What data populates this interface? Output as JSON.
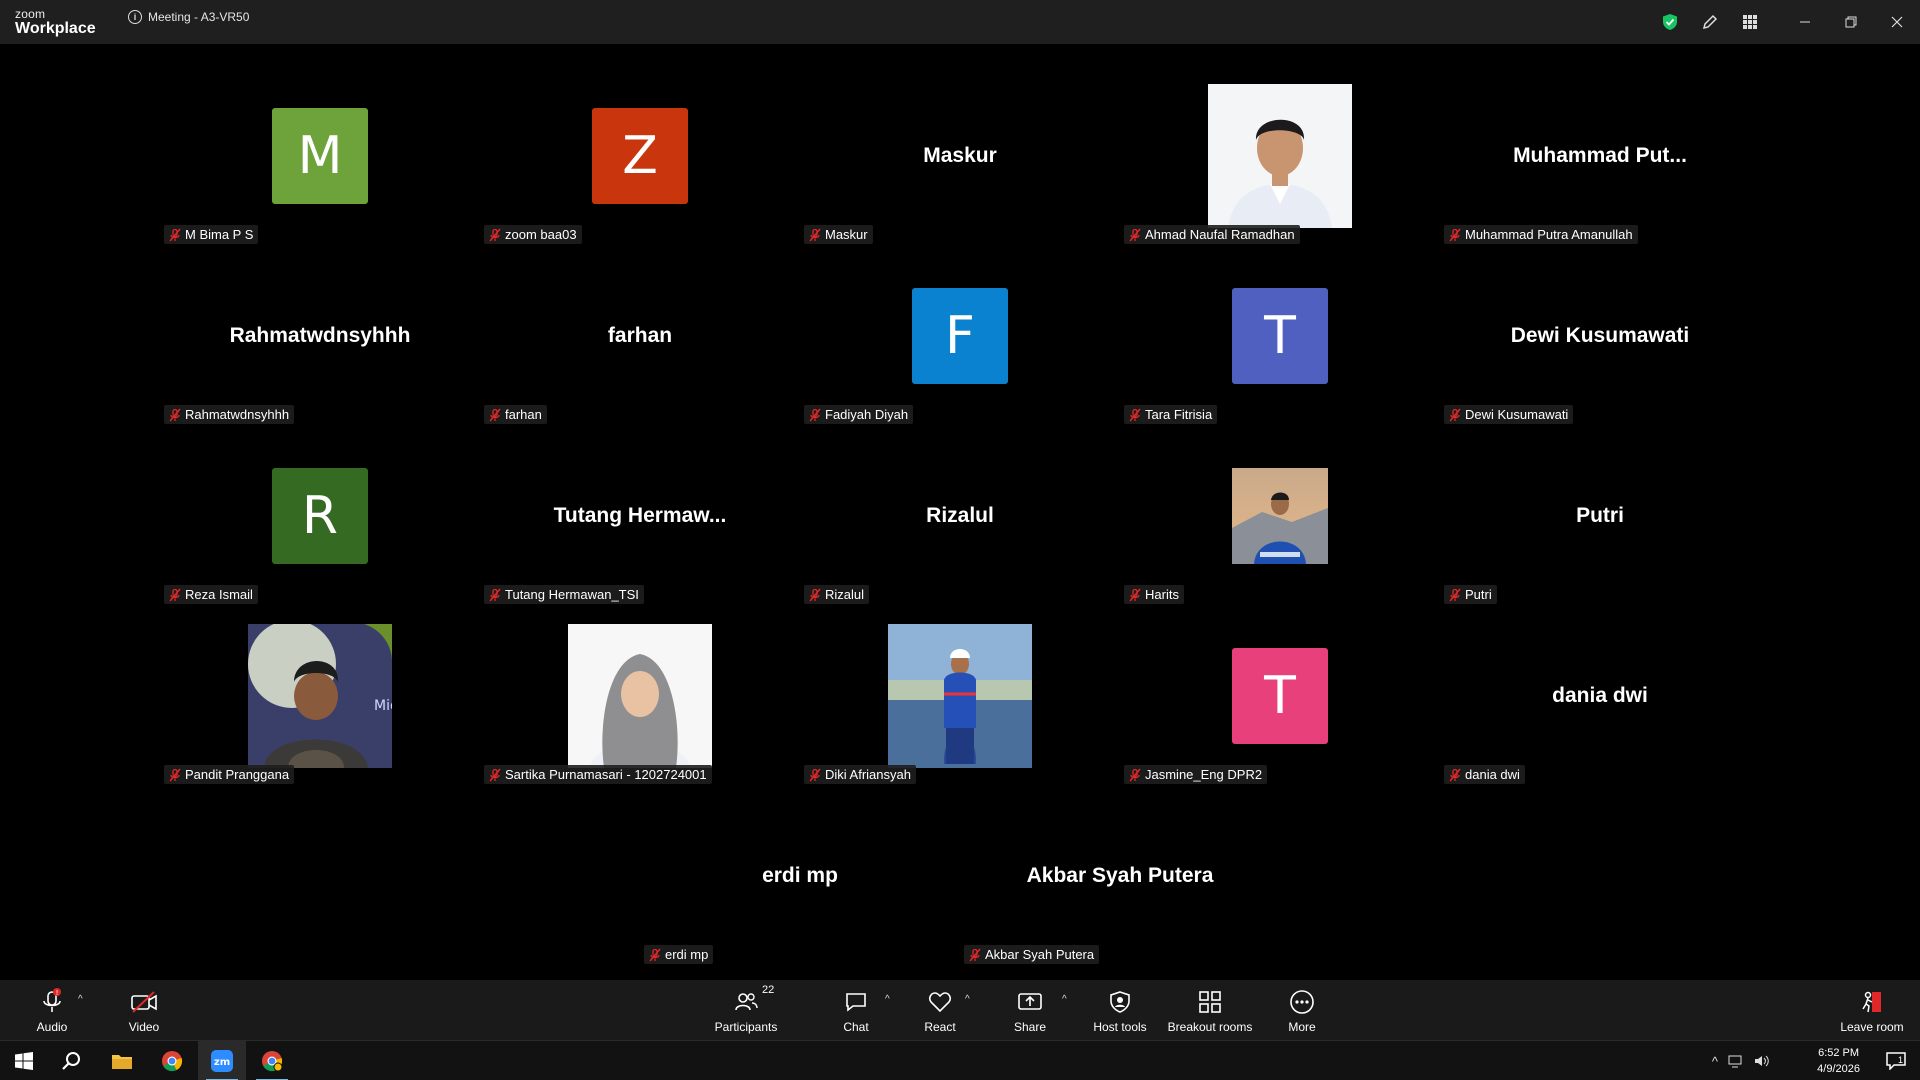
{
  "app": {
    "logo_line1": "zoom",
    "logo_line2": "Workplace",
    "meeting_title": "Meeting - A3-VR50"
  },
  "colors": {
    "muted_mic": "#e02828",
    "shield": "#19c463",
    "accent_blue": "#76b9ed"
  },
  "participants": [
    {
      "display": "avatar",
      "letter": "M",
      "bg": "#6ea23a",
      "label": "M Bima P S"
    },
    {
      "display": "avatar",
      "letter": "Z",
      "bg": "#c9360e",
      "label": "zoom baa03"
    },
    {
      "display": "name",
      "big": "Maskur",
      "label": "Maskur"
    },
    {
      "display": "photo",
      "photo": "portrait-man-formal",
      "label": "Ahmad Naufal Ramadhan"
    },
    {
      "display": "name",
      "big": "Muhammad  Put...",
      "label": "Muhammad Putra Amanullah"
    },
    {
      "display": "name",
      "big": "Rahmatwdnsyhhh",
      "label": "Rahmatwdnsyhhh"
    },
    {
      "display": "name",
      "big": "farhan",
      "label": "farhan"
    },
    {
      "display": "avatar",
      "letter": "F",
      "bg": "#0b82d0",
      "label": "Fadiyah Diyah"
    },
    {
      "display": "avatar",
      "letter": "T",
      "bg": "#5060c0",
      "label": "Tara Fitrisia"
    },
    {
      "display": "name",
      "big": "Dewi Kusumawati",
      "label": "Dewi Kusumawati"
    },
    {
      "display": "avatar",
      "letter": "R",
      "bg": "#346a22",
      "label": "Reza Ismail"
    },
    {
      "display": "name",
      "big": "Tutang  Hermaw...",
      "label": "Tutang Hermawan_TSI"
    },
    {
      "display": "name",
      "big": "Rizalul",
      "label": "Rizalul"
    },
    {
      "display": "photo-small",
      "photo": "man-mountain-jacket",
      "label": "Harits"
    },
    {
      "display": "name",
      "big": "Putri",
      "label": "Putri"
    },
    {
      "display": "photo",
      "photo": "man-batik-stage",
      "label": "Pandit Pranggana"
    },
    {
      "display": "photo",
      "photo": "woman-hijab-portrait",
      "label": "Sartika Purnamasari - 1202724001"
    },
    {
      "display": "photo",
      "photo": "man-helmet-outdoor",
      "label": "Diki Afriansyah"
    },
    {
      "display": "avatar",
      "letter": "T",
      "bg": "#e8407a",
      "label": "Jasmine_Eng DPR2"
    },
    {
      "display": "name",
      "big": "dania dwi",
      "label": "dania dwi"
    },
    {
      "display": "name",
      "big": "erdi mp",
      "label": "erdi mp"
    },
    {
      "display": "name",
      "big": "Akbar Syah Putera",
      "label": "Akbar Syah Putera"
    }
  ],
  "toolbar": {
    "audio": "Audio",
    "video": "Video",
    "participants": "Participants",
    "participant_count": "22",
    "chat": "Chat",
    "react": "React",
    "share": "Share",
    "host_tools": "Host tools",
    "breakout": "Breakout rooms",
    "more": "More",
    "leave": "Leave room"
  },
  "taskbar": {
    "time": "6:52 PM",
    "date": "4/9/2026",
    "notif_count": "1"
  }
}
